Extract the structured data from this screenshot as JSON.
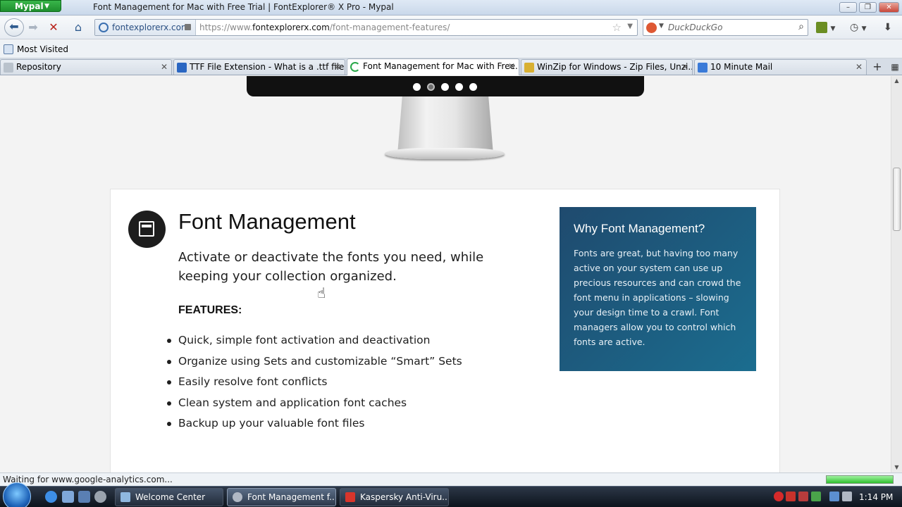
{
  "browser": {
    "app_button": "Mypal",
    "window_title": "Font Management for Mac with Free Trial | FontExplorer® X Pro - Mypal",
    "identity": "fontexplorerx.com",
    "url_prefix": "https://www.",
    "url_domain": "fontexplorerx.com",
    "url_path": "/font-management-features/",
    "search_placeholder": "DuckDuckGo"
  },
  "bookmarks": [
    {
      "label": "Most Visited"
    }
  ],
  "tabs": [
    {
      "label": "Repository",
      "active": false
    },
    {
      "label": "TTF File Extension - What is a .ttf file ...",
      "active": false
    },
    {
      "label": "Font Management for Mac with Free...",
      "active": true
    },
    {
      "label": "WinZip for Windows - Zip Files, Unzi...",
      "active": false
    },
    {
      "label": "10 Minute Mail",
      "active": false
    }
  ],
  "slider": {
    "total": 5,
    "current": 2
  },
  "page": {
    "title": "Font Management",
    "lead": "Activate or deactivate the fonts you need, while keeping your collection organized.",
    "features_heading": "FEATURES:",
    "features": [
      "Quick, simple font activation and deactivation",
      "Organize using Sets and customizable “Smart” Sets",
      "Easily resolve font conflicts",
      "Clean system and application font caches",
      "Backup up your valuable font files"
    ],
    "sidebar_title": "Why Font Management?",
    "sidebar_text": "Fonts are great, but having too many active on your system can use up precious resources and can crowd the font menu in applications – slowing your design time to a crawl. Font managers allow you to control which fonts are active."
  },
  "status": {
    "text": "Waiting for www.google-analytics.com..."
  },
  "taskbar": {
    "tasks": [
      {
        "label": "Welcome Center",
        "active": false
      },
      {
        "label": "Font Management f...",
        "active": true
      },
      {
        "label": "Kaspersky Anti-Viru...",
        "active": false
      }
    ],
    "clock": "1:14 PM"
  }
}
